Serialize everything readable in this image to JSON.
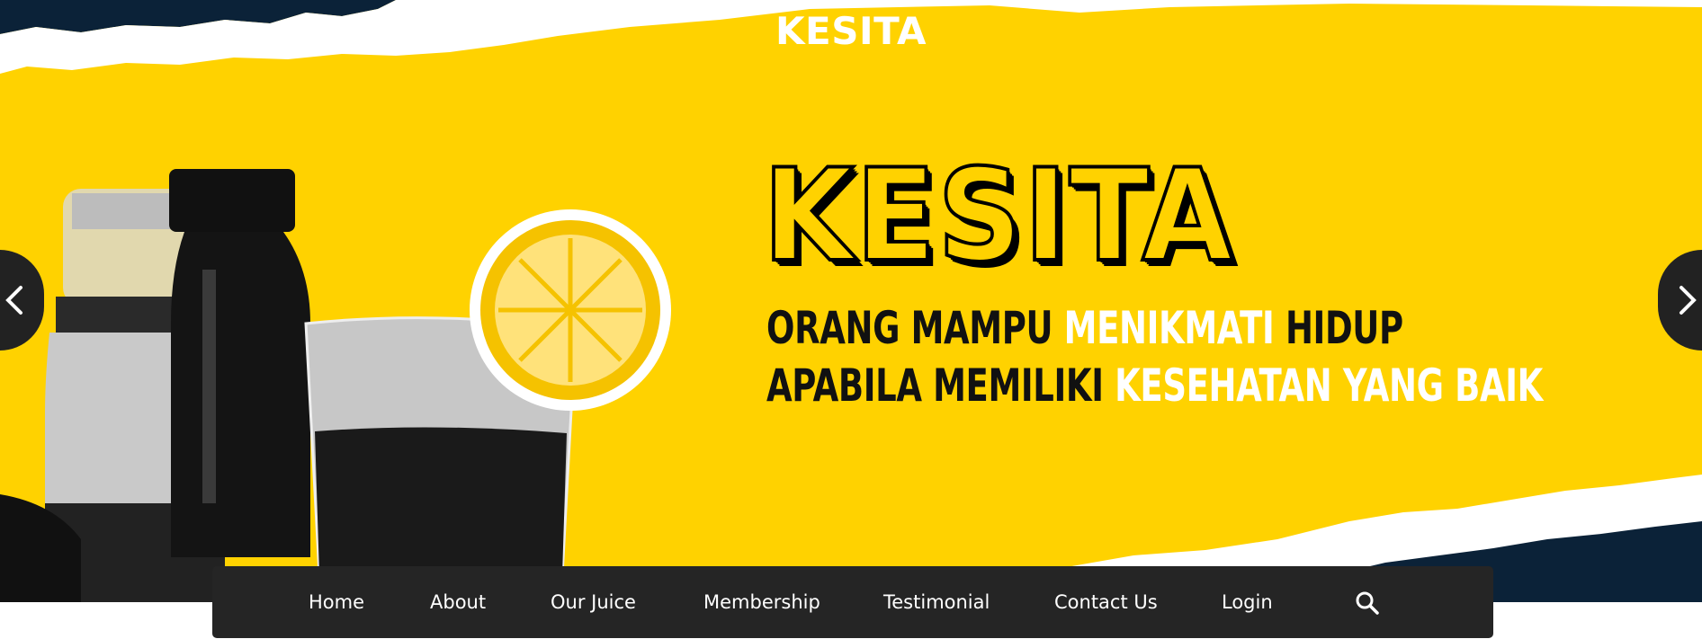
{
  "site": {
    "title": "KESITA"
  },
  "hero": {
    "brand": "KESITA",
    "tagline_line1": [
      {
        "text": "ORANG MAMPU ",
        "highlight": false
      },
      {
        "text": "MENIKMATI",
        "highlight": true
      },
      {
        "text": " HIDUP",
        "highlight": false
      }
    ],
    "tagline_line2": [
      {
        "text": "APABILA MEMILIKI ",
        "highlight": false
      },
      {
        "text": "KESEHATAN YANG BAIK",
        "highlight": true
      }
    ],
    "colors": {
      "background": "#ffd200",
      "torn_edge": "#0b2238",
      "paper": "#ffffff"
    },
    "carousel": {
      "prev_icon": "chevron-left-icon",
      "next_icon": "chevron-right-icon"
    }
  },
  "navbar": {
    "items": [
      {
        "label": "Home"
      },
      {
        "label": "About"
      },
      {
        "label": "Our Juice"
      },
      {
        "label": "Membership"
      },
      {
        "label": "Testimonial"
      },
      {
        "label": "Contact Us"
      },
      {
        "label": "Login"
      }
    ],
    "search_icon": "search-icon",
    "background": "#252525"
  }
}
